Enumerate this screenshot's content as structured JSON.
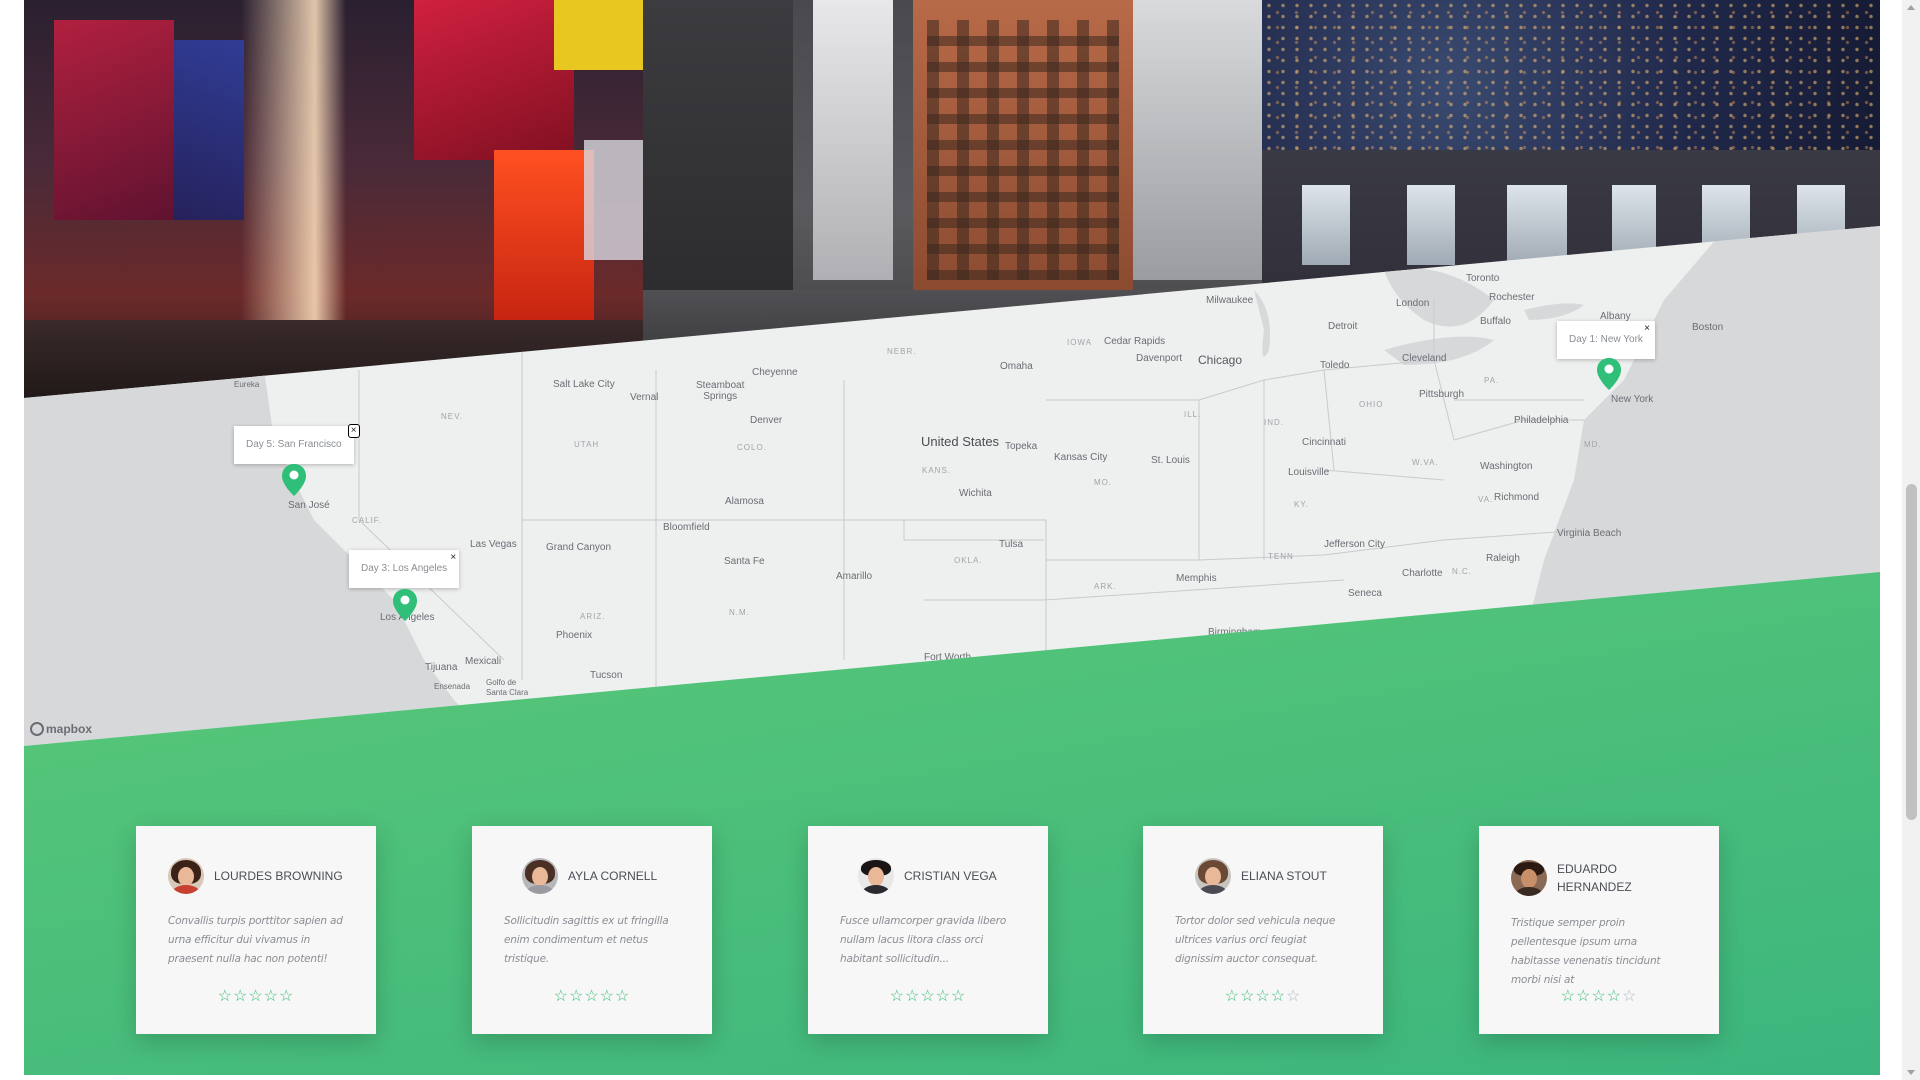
{
  "photos": [
    {
      "name": "times-square-photo"
    },
    {
      "name": "city-street-photo"
    },
    {
      "name": "hollywood-sign-photo"
    }
  ],
  "map": {
    "attribution": "mapbox",
    "country_label": "United States",
    "popups": [
      {
        "label": "Day 1: New York",
        "close": "×"
      },
      {
        "label": "Day 5: San Francisco",
        "close": "×"
      },
      {
        "label": "Day 3: Los Angeles",
        "close": "×"
      }
    ],
    "cities": {
      "milwaukee": "Milwaukee",
      "toronto": "Toronto",
      "london": "London",
      "rochester": "Rochester",
      "buffalo": "Buffalo",
      "albany": "Albany",
      "boston": "Boston",
      "detroit": "Detroit",
      "cedar_rapids": "Cedar Rapids",
      "davenport": "Davenport",
      "chicago": "Chicago",
      "toledo": "Toledo",
      "cleveland": "Cleveland",
      "pittsburgh": "Pittsburgh",
      "new_york": "New York",
      "philadelphia": "Philadelphia",
      "washington": "Washington",
      "richmond": "Richmond",
      "virginia_beach": "Virginia Beach",
      "raleigh": "Raleigh",
      "charlotte": "Charlotte",
      "seneca": "Seneca",
      "birmingham": "Birmingham",
      "memphis": "Memphis",
      "jefferson_city": "Jefferson City",
      "louisville": "Louisville",
      "cincinnati": "Cincinnati",
      "st_louis": "St. Louis",
      "kansas_city": "Kansas City",
      "topeka": "Topeka",
      "wichita": "Wichita",
      "tulsa": "Tulsa",
      "omaha": "Omaha",
      "amarillo": "Amarillo",
      "fort_worth": "Fort Worth",
      "denver": "Denver",
      "cheyenne": "Cheyenne",
      "alamosa": "Alamosa",
      "bloomfield": "Bloomfield",
      "santa_fe": "Santa Fe",
      "salt_lake_city": "Salt Lake City",
      "vernal": "Vernal",
      "steamboat_springs": "Steamboat\nSprings",
      "grand_canyon": "Grand Canyon",
      "las_vegas": "Las Vegas",
      "phoenix": "Phoenix",
      "tucson": "Tucson",
      "mexicali": "Mexicali",
      "tijuana": "Tijuana",
      "ensenada": "Ensenada",
      "golfo": "Golfo de\nSanta Clara",
      "los_angeles": "Los Angeles",
      "san_jose": "San José",
      "eureka": "Eureka"
    },
    "states": {
      "nebr": "NEBR.",
      "iowa": "IOWA",
      "ill": "ILL.",
      "ind": "IND.",
      "ohio": "OHIO",
      "pa": "PA.",
      "md": "MD.",
      "va": "VA.",
      "wva": "W.VA.",
      "ky": "KY.",
      "tenn": "TENN",
      "nc": "N.C.",
      "ark": "ARK.",
      "mo": "MO.",
      "kans": "KANS.",
      "okla": "OKLA.",
      "colo": "COLO.",
      "utah": "UTAH",
      "nev": "NEV.",
      "calif": "CALIF.",
      "ariz": "ARIZ.",
      "nm": "N.M."
    }
  },
  "testimonials": [
    {
      "name": "LOURDES BROWNING",
      "quote": "Convallis turpis porttitor sapien ad urna efficitur dui vivamus in praesent nulla hac non potenti!",
      "rating": 5,
      "stars": "☆☆☆☆☆",
      "empty_stars": ""
    },
    {
      "name": "AYLA CORNELL",
      "quote": "Sollicitudin sagittis ex ut fringilla enim condimentum et netus tristique.",
      "rating": 5,
      "stars": "☆☆☆☆☆",
      "empty_stars": ""
    },
    {
      "name": "CRISTIAN VEGA",
      "quote": "Fusce ullamcorper gravida libero nullam lacus litora class orci habitant sollicitudin...",
      "rating": 5,
      "stars": "☆☆☆☆☆",
      "empty_stars": ""
    },
    {
      "name": "ELIANA STOUT",
      "quote": "Tortor dolor sed vehicula neque ultrices varius orci feugiat dignissim auctor consequat.",
      "rating": 4,
      "stars": "☆☆☆☆",
      "empty_stars": "☆"
    },
    {
      "name": "EDUARDO HERNANDEZ",
      "quote": "Tristique semper proin pellentesque ipsum urna habitasse venenatis tincidunt morbi nisi at",
      "rating": 4,
      "stars": "☆☆☆☆",
      "empty_stars": "☆"
    }
  ],
  "colors": {
    "green_start": "#6bd173",
    "green_end": "#3cb67e",
    "star": "#3fbd78",
    "marker": "#2fbf78"
  }
}
